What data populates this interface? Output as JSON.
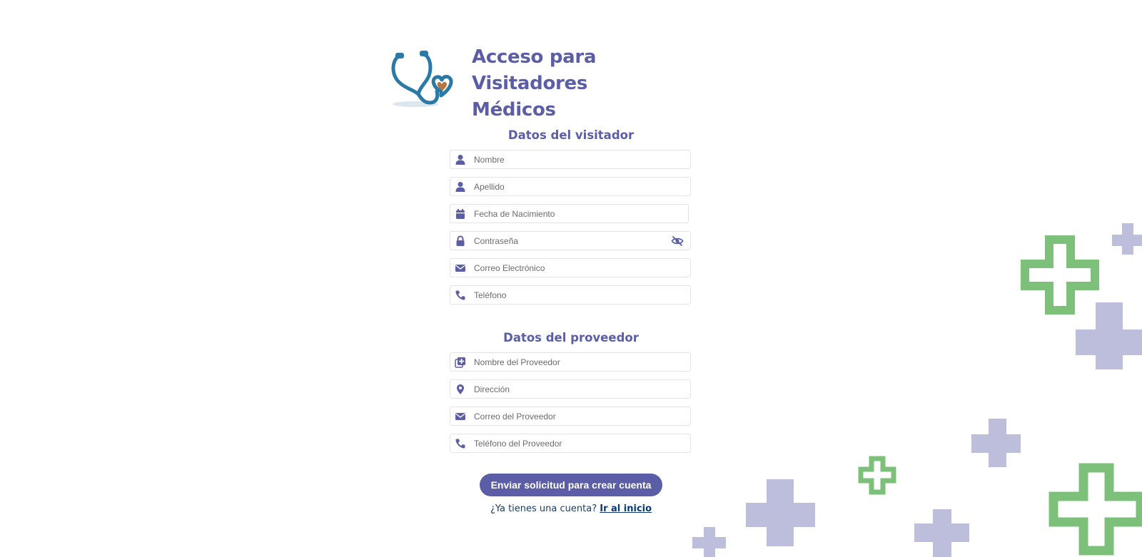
{
  "header": {
    "title_line1": "Acceso para Visitadores",
    "title_line2": "Médicos",
    "logo_icon": "stethoscope-heart-icon"
  },
  "visitor_section": {
    "title": "Datos del visitador",
    "fields": [
      {
        "placeholder": "Nombre",
        "icon": "user-icon",
        "value": ""
      },
      {
        "placeholder": "Apellido",
        "icon": "user-icon",
        "value": ""
      },
      {
        "placeholder": "Fecha de Nacimiento",
        "icon": "calendar-icon",
        "value": ""
      },
      {
        "placeholder": "Contraseña",
        "icon": "lock-icon",
        "value": "",
        "toggle_icon": "eye-slash-icon"
      },
      {
        "placeholder": "Correo Electrónico",
        "icon": "envelope-icon",
        "value": ""
      },
      {
        "placeholder": "Teléfono",
        "icon": "phone-icon",
        "value": ""
      }
    ]
  },
  "provider_section": {
    "title": "Datos del proveedor",
    "fields": [
      {
        "placeholder": "Nombre del Proveedor",
        "icon": "medical-plus-icon",
        "value": ""
      },
      {
        "placeholder": "Dirección",
        "icon": "location-pin-icon",
        "value": ""
      },
      {
        "placeholder": "Correo del Proveedor",
        "icon": "envelope-icon",
        "value": ""
      },
      {
        "placeholder": "Teléfono del Proveedor",
        "icon": "phone-icon",
        "value": ""
      }
    ]
  },
  "actions": {
    "submit_label": "Enviar solicitud para crear cuenta",
    "login_prompt": "¿Ya tienes una cuenta?",
    "login_link": "Ir al inicio"
  },
  "colors": {
    "primary": "#5b5ea6",
    "cross_purple": "#bcbedc",
    "cross_green": "#7cc07a"
  }
}
